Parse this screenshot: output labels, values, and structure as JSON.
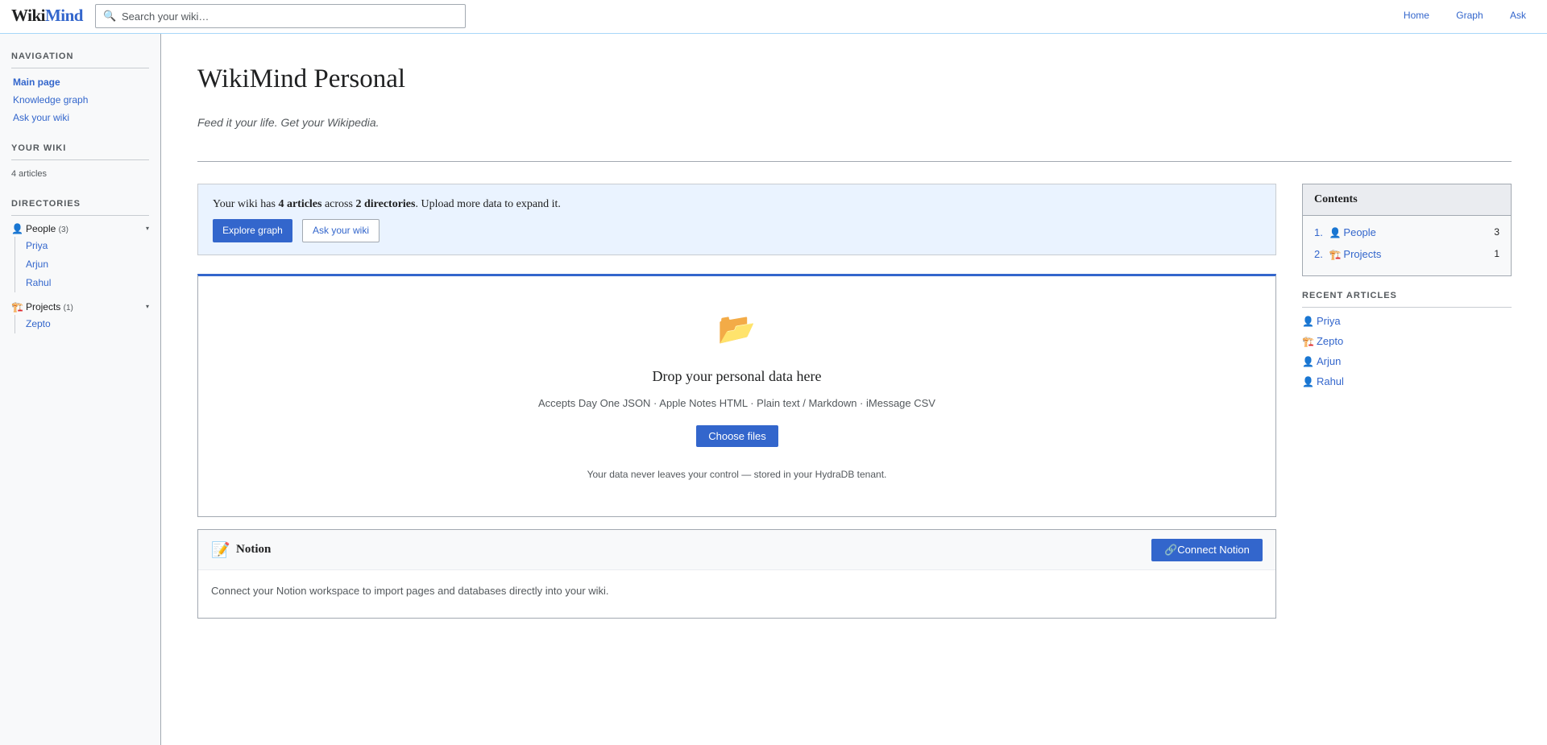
{
  "header": {
    "logo_part1": "Wiki",
    "logo_part2": "Mind",
    "search_placeholder": "Search your wiki…",
    "search_icon": "🔍",
    "nav": [
      "Home",
      "Graph",
      "Ask"
    ]
  },
  "sidebar": {
    "navigation_heading": "Navigation",
    "navigation_items": [
      "Main page",
      "Knowledge graph",
      "Ask your wiki"
    ],
    "yourwiki_heading": "Your wiki",
    "article_count": "4 articles",
    "directories_heading": "Directories",
    "directories": [
      {
        "icon": "👤",
        "name": "People",
        "count": "(3)",
        "items": [
          "Priya",
          "Arjun",
          "Rahul"
        ]
      },
      {
        "icon": "🏗️",
        "name": "Projects",
        "count": "(1)",
        "items": [
          "Zepto"
        ]
      }
    ],
    "caret": "▾"
  },
  "main": {
    "title": "WikiMind Personal",
    "tagline": "Feed it your life. Get your Wikipedia.",
    "info": {
      "prefix": "Your wiki has ",
      "articles": "4 articles",
      "middle": " across ",
      "directories": "2 directories",
      "suffix": ". Upload more data to expand it.",
      "explore_button": "Explore graph",
      "ask_button": "Ask your wiki"
    },
    "dropzone": {
      "icon": "📂",
      "title": "Drop your personal data here",
      "accepts": "Accepts Day One JSON · Apple Notes HTML · Plain text / Markdown · iMessage CSV",
      "button": "Choose files",
      "note": "Your data never leaves your control — stored in your HydraDB tenant."
    },
    "notion": {
      "icon": "📝",
      "title": "Notion",
      "button": "🔗Connect Notion",
      "description": "Connect your Notion workspace to import pages and databases directly into your wiki."
    }
  },
  "right": {
    "contents_heading": "Contents",
    "contents": [
      {
        "num": "1.",
        "icon": "👤",
        "label": "People",
        "count": "3"
      },
      {
        "num": "2.",
        "icon": "🏗️",
        "label": "Projects",
        "count": "1"
      }
    ],
    "recent_heading": "RECENT ARTICLES",
    "recent": [
      {
        "icon": "👤",
        "label": "Priya"
      },
      {
        "icon": "🏗️",
        "label": "Zepto"
      },
      {
        "icon": "👤",
        "label": "Arjun"
      },
      {
        "icon": "👤",
        "label": "Rahul"
      }
    ]
  },
  "colors": {
    "accent": "#3366cc",
    "info_bg": "#eaf3ff",
    "sidebar_bg": "#f8f9fa"
  }
}
